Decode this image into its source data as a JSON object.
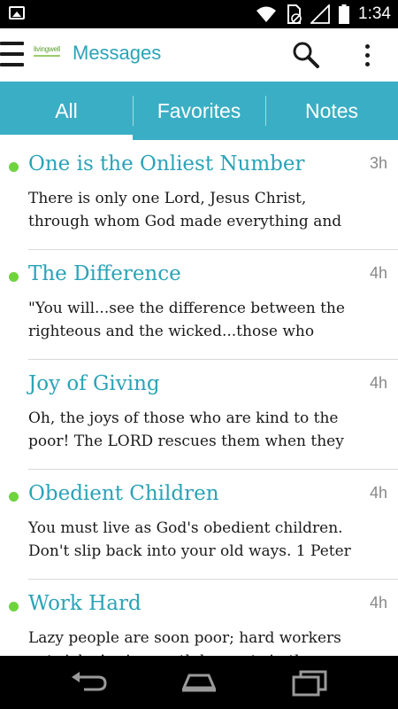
{
  "status_bar": {
    "time": "1:34",
    "icons": [
      "image-icon",
      "wifi-icon",
      "sim-off-icon",
      "signal-icon",
      "battery-icon"
    ]
  },
  "app_bar": {
    "logo_text": "livingwell",
    "title": "Messages",
    "icons": [
      "menu-icon",
      "search-icon",
      "overflow-menu-icon"
    ]
  },
  "tabs": [
    {
      "label": "All",
      "selected": true
    },
    {
      "label": "Favorites",
      "selected": false
    },
    {
      "label": "Notes",
      "selected": false
    }
  ],
  "messages": [
    {
      "title": "One is the Onliest Number",
      "time": "3h",
      "unread": true,
      "preview": "There is only one Lord, Jesus Christ,\nthrough whom God made everything and"
    },
    {
      "title": "The Difference",
      "time": "4h",
      "unread": true,
      "preview": "\"You will...see the difference between the\nrighteous and the wicked...those who"
    },
    {
      "title": "Joy of Giving",
      "time": "4h",
      "unread": false,
      "preview": "Oh, the joys of those who are kind to the\npoor! The LORD rescues them when they"
    },
    {
      "title": "Obedient Children",
      "time": "4h",
      "unread": true,
      "preview": "You must live as God's obedient children.\nDon't slip back into your old ways. 1 Peter"
    },
    {
      "title": "Work Hard",
      "time": "4h",
      "unread": true,
      "preview": "Lazy people are soon poor; hard workers\nget rich. A wise youth harvests in the"
    }
  ],
  "colors": {
    "accent": "#2aa3b8",
    "tab_bar": "#3aaec4",
    "unread_dot": "#6fd33f",
    "body_text": "#1a1a1a",
    "time_text": "#888888"
  },
  "nav_bar": {
    "icons": [
      "back-icon",
      "home-icon",
      "recent-apps-icon"
    ]
  }
}
